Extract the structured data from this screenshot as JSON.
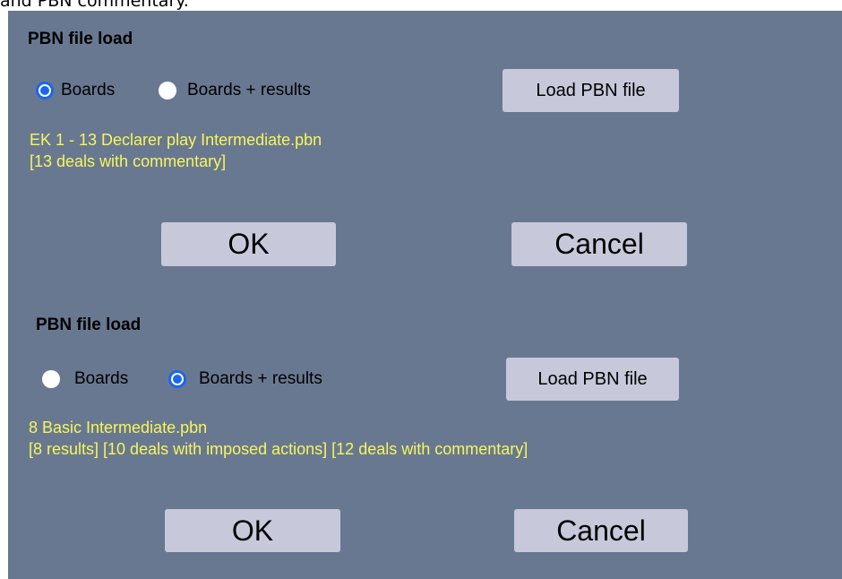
{
  "caption": "and PBN commentary.",
  "dialogs": [
    {
      "title": "PBN file load",
      "radio_boards": "Boards",
      "radio_boards_results": "Boards + results",
      "selected": "Boards",
      "load_button": "Load PBN file",
      "file_name": "EK 1 - 13 Declarer play Intermediate.pbn",
      "file_info": "[13 deals with commentary]",
      "ok": "OK",
      "cancel": "Cancel"
    },
    {
      "title": "PBN file load",
      "radio_boards": "Boards",
      "radio_boards_results": "Boards + results",
      "selected": "Boards + results",
      "load_button": "Load PBN file",
      "file_name": "8 Basic Intermediate.pbn",
      "file_info": "[8 results] [10 deals with imposed actions] [12 deals with commentary]",
      "ok": "OK",
      "cancel": "Cancel"
    }
  ],
  "colors": {
    "panel": "#697891",
    "button": "#c7c9db",
    "info_text": "#f6f65a",
    "radio_accent": "#1a66f0"
  }
}
